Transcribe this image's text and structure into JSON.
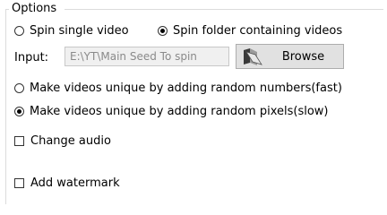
{
  "group": {
    "title": "Options"
  },
  "spin_mode": {
    "single_label": "Spin single video",
    "folder_label": "Spin folder containing videos",
    "selected": "folder"
  },
  "input": {
    "label": "Input:",
    "value": "E:\\YT\\Main Seed To spin",
    "browse_label": "Browse",
    "browse_icon": "folder-icon"
  },
  "uniqueness": {
    "numbers_label": "Make videos unique by adding random numbers(fast)",
    "pixels_label": "Make videos unique by adding random pixels(slow)",
    "selected": "pixels"
  },
  "options": {
    "change_audio_label": "Change audio",
    "change_audio_checked": false,
    "add_watermark_label": "Add watermark",
    "add_watermark_checked": false
  }
}
